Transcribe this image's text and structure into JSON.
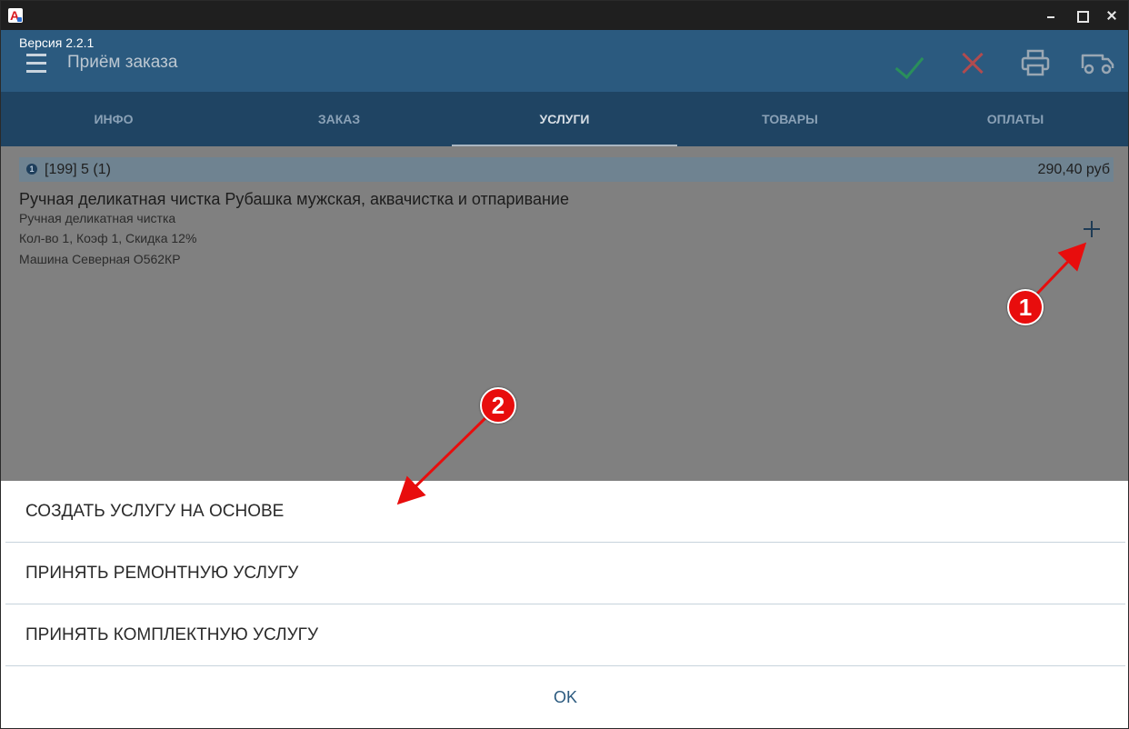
{
  "app": {
    "version": "Версия 2.2.1",
    "screen_title": "Приём заказа"
  },
  "header_icons": [
    "check-icon",
    "cancel-x-icon",
    "printer-icon",
    "truck-icon"
  ],
  "tabs": [
    {
      "label": "ИНФО",
      "active": false
    },
    {
      "label": "ЗАКАЗ",
      "active": false
    },
    {
      "label": "УСЛУГИ",
      "active": true
    },
    {
      "label": "ТОВАРЫ",
      "active": false
    },
    {
      "label": "ОПЛАТЫ",
      "active": false
    }
  ],
  "order": {
    "id_text": "[199] 5 (1)",
    "price": "290,40 руб",
    "service_title": "Ручная деликатная чистка Рубашка мужская, аквачистка и отпаривание",
    "lines": [
      "Ручная деликатная чистка",
      "Кол-во 1, Коэф 1, Скидка 12%",
      "Машина Северная О562КР"
    ]
  },
  "sheet": {
    "items": [
      "СОЗДАТЬ УСЛУГУ НА ОСНОВЕ",
      "ПРИНЯТЬ РЕМОНТНУЮ УСЛУГУ",
      "ПРИНЯТЬ КОМПЛЕКТНУЮ УСЛУГУ"
    ],
    "ok": "OK"
  },
  "annotations": {
    "badge1": "1",
    "badge2": "2"
  },
  "colors": {
    "header": "#2b5a7f",
    "tabs": "#1f4463",
    "annotation_red": "#e80d0d",
    "check_green": "#2a8f5b",
    "cancel_red": "#b04b4f"
  }
}
